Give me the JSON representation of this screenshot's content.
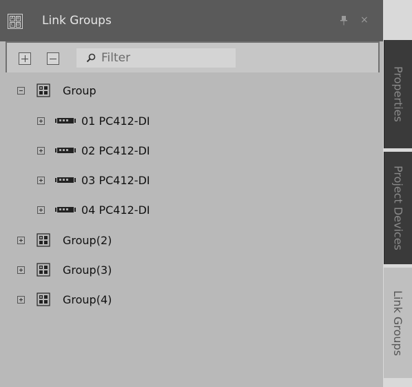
{
  "panel": {
    "title": "Link Groups",
    "title_icon_letters": [
      "A",
      "B",
      "C",
      "D"
    ],
    "pin_icon": "pin-icon",
    "close_glyph": "×"
  },
  "toolbar": {
    "expand_all_icon": "plus-box-icon",
    "collapse_all_icon": "minus-box-icon",
    "filter_placeholder": "Filter",
    "filter_value": "",
    "filter_icon": "search-icon"
  },
  "tree": {
    "group": {
      "label": "Group",
      "expanded": true
    },
    "devices": [
      {
        "label": "01 PC412-DI"
      },
      {
        "label": "02 PC412-DI"
      },
      {
        "label": "03 PC412-DI"
      },
      {
        "label": "04 PC412-DI"
      }
    ],
    "other_groups": [
      {
        "label": "Group(2)"
      },
      {
        "label": "Group(3)"
      },
      {
        "label": "Group(4)"
      }
    ]
  },
  "side_tabs": [
    {
      "label": "Properties",
      "active": false
    },
    {
      "label": "Project Devices",
      "active": false
    },
    {
      "label": "Link Groups",
      "active": true
    }
  ],
  "colors": {
    "panel_bg": "#b9b9b9",
    "titlebar_bg": "#5a5a5a",
    "tab_dark": "#3a3a3a",
    "tab_active": "#bfbfbf"
  }
}
